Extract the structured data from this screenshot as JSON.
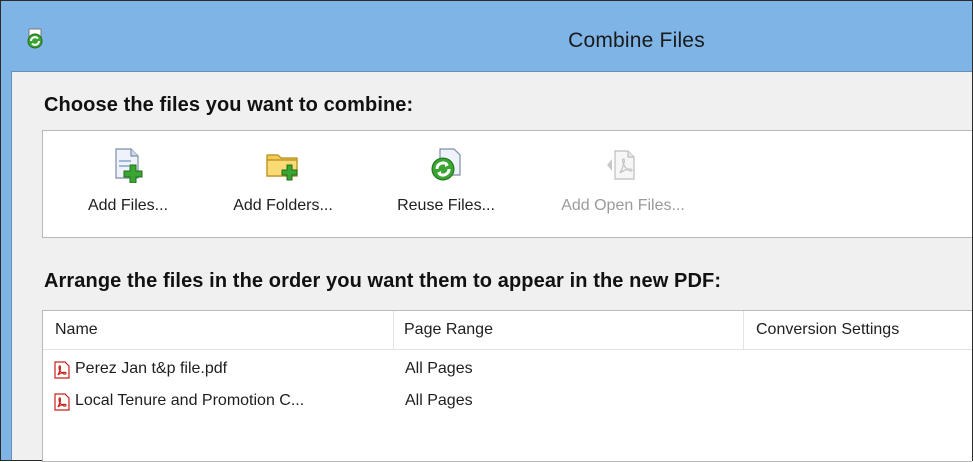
{
  "window": {
    "title": "Combine Files",
    "icon": "combine-files-icon"
  },
  "sections": {
    "choose_heading": "Choose the files you want to combine:",
    "arrange_heading": "Arrange the files in the order you want them to appear in the new PDF:"
  },
  "toolbar": {
    "items": [
      {
        "label": "Add Files...",
        "icon": "add-file-icon",
        "enabled": true
      },
      {
        "label": "Add Folders...",
        "icon": "add-folder-icon",
        "enabled": true
      },
      {
        "label": "Reuse Files...",
        "icon": "reuse-files-icon",
        "enabled": true
      },
      {
        "label": "Add Open Files...",
        "icon": "add-open-files-icon",
        "enabled": false
      }
    ]
  },
  "file_list": {
    "columns": [
      "Name",
      "Page Range",
      "Conversion Settings"
    ],
    "rows": [
      {
        "name": "Perez Jan t&p file.pdf",
        "page_range": "All Pages",
        "icon": "pdf-icon"
      },
      {
        "name": "Local Tenure and Promotion C...",
        "page_range": "All Pages",
        "icon": "pdf-icon"
      }
    ]
  },
  "colors": {
    "titlebar": "#7fb4e6",
    "panel": "#f0f0f0",
    "pdf_red": "#c8201b",
    "plus_green": "#3aa532"
  }
}
